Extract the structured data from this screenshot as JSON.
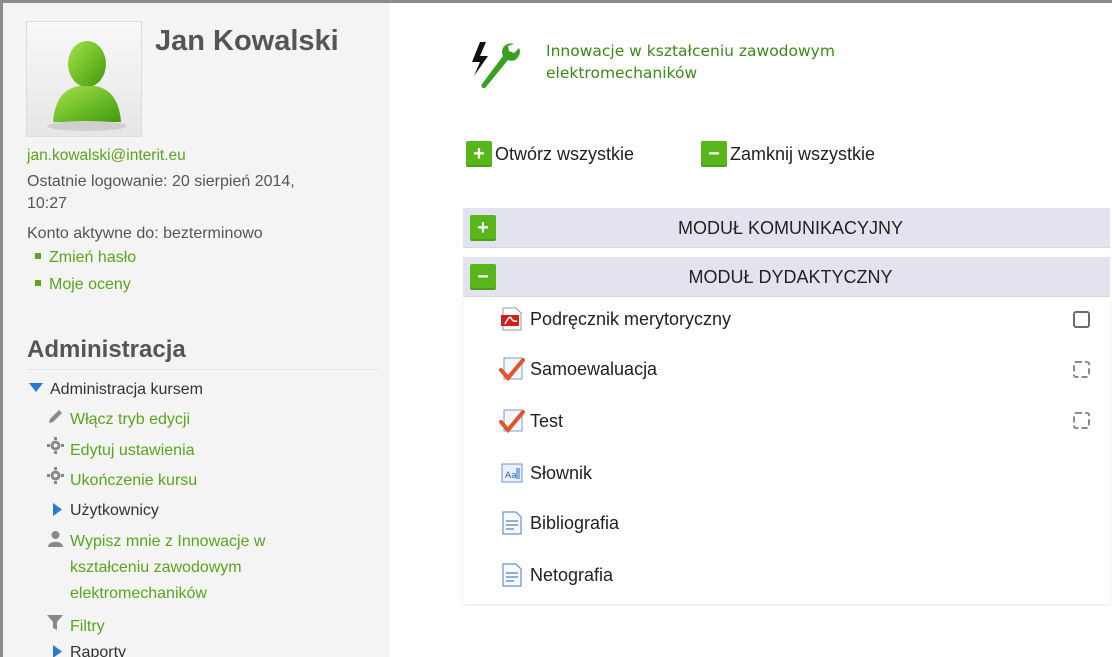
{
  "user": {
    "name": "Jan Kowalski",
    "email": "jan.kowalski@interit.eu",
    "last_login_line1": "Ostatnie logowanie: 20 sierpień 2014,",
    "last_login_line2": "10:27",
    "account_active": "Konto aktywne do: bezterminowo",
    "links": [
      "Zmień hasło",
      "Moje oceny"
    ]
  },
  "admin": {
    "title": "Administracja",
    "course_admin": "Administracja kursem",
    "items": {
      "edit_mode": "Włącz tryb edycji",
      "edit_settings": "Edytuj ustawienia",
      "course_completion": "Ukończenie kursu",
      "users": "Użytkownicy",
      "unenrol_line1": "Wypisz mnie z Innowacje w",
      "unenrol_line2": "kształceniu zawodowym",
      "unenrol_line3": "elektromechaników",
      "filters": "Filtry",
      "reports": "Raporty"
    }
  },
  "course": {
    "title_line1": "Innowacje w kształceniu zawodowym",
    "title_line2": "elektromechaników",
    "expand_all": "Otwórz wszystkie",
    "collapse_all": "Zamknij wszystkie",
    "modules": [
      {
        "label": "MODUŁ KOMUNIKACYJNY",
        "state": "collapsed"
      },
      {
        "label": "MODUŁ DYDAKTYCZNY",
        "state": "expanded"
      }
    ],
    "activities": [
      {
        "label": "Podręcznik merytoryczny",
        "icon": "pdf-icon",
        "completion": "manual"
      },
      {
        "label": "Samoewaluacja",
        "icon": "quiz-icon",
        "completion": "auto"
      },
      {
        "label": "Test",
        "icon": "quiz-icon",
        "completion": "auto"
      },
      {
        "label": "Słownik",
        "icon": "glossary-icon",
        "completion": "none"
      },
      {
        "label": "Bibliografia",
        "icon": "page-icon",
        "completion": "none"
      },
      {
        "label": "Netografia",
        "icon": "page-icon",
        "completion": "none"
      }
    ]
  },
  "colors": {
    "link_green": "#5aa51e",
    "button_green": "#57b61a",
    "module_header": "#e3e3ef",
    "sidebar_bg": "#f4f4f4"
  }
}
